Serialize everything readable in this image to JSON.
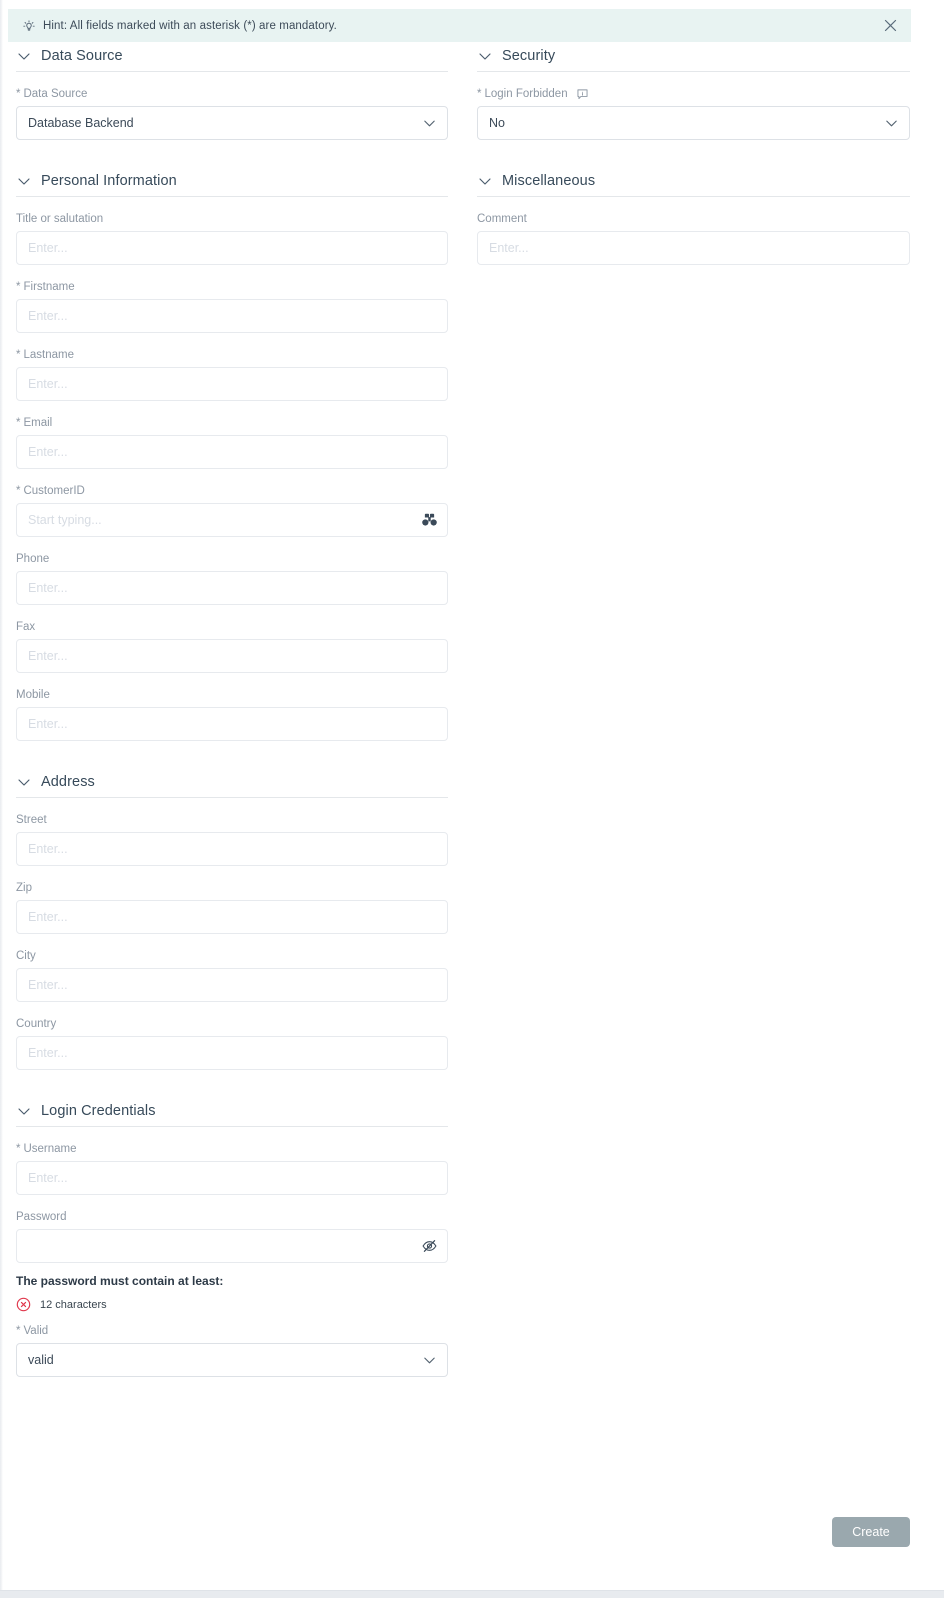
{
  "hint": {
    "icon": "lightbulb-icon",
    "text": "Hint: All fields marked with an asterisk (*) are mandatory.",
    "close_icon": "close-icon",
    "background_color": "#e8f3f2"
  },
  "placeholders": {
    "enter": "Enter...",
    "start_typing": "Start typing..."
  },
  "left_column": {
    "sections": [
      {
        "title": "Data Source",
        "chevron": "chevron-down-icon",
        "fields": [
          {
            "label": "Data Source",
            "required": true,
            "type": "select",
            "value": "Database Backend",
            "name": "data-source-select"
          }
        ]
      },
      {
        "title": "Personal Information",
        "chevron": "chevron-down-icon",
        "fields": [
          {
            "label": "Title or salutation",
            "required": false,
            "type": "text",
            "value": "",
            "placeholder": "Enter...",
            "name": "title-or-salutation-input"
          },
          {
            "label": "Firstname",
            "required": true,
            "type": "text",
            "value": "",
            "placeholder": "Enter...",
            "name": "firstname-input"
          },
          {
            "label": "Lastname",
            "required": true,
            "type": "text",
            "value": "",
            "placeholder": "Enter...",
            "name": "lastname-input"
          },
          {
            "label": "Email",
            "required": true,
            "type": "text",
            "value": "",
            "placeholder": "Enter...",
            "name": "email-input"
          },
          {
            "label": "CustomerID",
            "required": true,
            "type": "text",
            "value": "",
            "placeholder": "Start typing...",
            "icon": "binoculars-icon",
            "name": "customer-id-input"
          },
          {
            "label": "Phone",
            "required": false,
            "type": "text",
            "value": "",
            "placeholder": "Enter...",
            "name": "phone-input"
          },
          {
            "label": "Fax",
            "required": false,
            "type": "text",
            "value": "",
            "placeholder": "Enter...",
            "name": "fax-input"
          },
          {
            "label": "Mobile",
            "required": false,
            "type": "text",
            "value": "",
            "placeholder": "Enter...",
            "name": "mobile-input"
          }
        ]
      },
      {
        "title": "Address",
        "chevron": "chevron-down-icon",
        "fields": [
          {
            "label": "Street",
            "required": false,
            "type": "text",
            "value": "",
            "placeholder": "Enter...",
            "name": "street-input"
          },
          {
            "label": "Zip",
            "required": false,
            "type": "text",
            "value": "",
            "placeholder": "Enter...",
            "name": "zip-input"
          },
          {
            "label": "City",
            "required": false,
            "type": "text",
            "value": "",
            "placeholder": "Enter...",
            "name": "city-input"
          },
          {
            "label": "Country",
            "required": false,
            "type": "text",
            "value": "",
            "placeholder": "Enter...",
            "name": "country-input"
          }
        ]
      },
      {
        "title": "Login Credentials",
        "chevron": "chevron-down-icon",
        "fields": [
          {
            "label": "Username",
            "required": true,
            "type": "text",
            "value": "",
            "placeholder": "Enter...",
            "name": "username-input"
          },
          {
            "label": "Password",
            "required": false,
            "type": "password",
            "value": "",
            "placeholder": "",
            "icon": "eye-off-icon",
            "name": "password-input"
          }
        ]
      }
    ],
    "password_rules": {
      "title": "The password must contain at least:",
      "rules": [
        {
          "text": "12 characters",
          "state": "invalid",
          "icon": "x-circle-icon",
          "color": "#e0384d"
        }
      ]
    },
    "valid_field": {
      "label": "Valid",
      "required": true,
      "type": "select",
      "value": "valid",
      "name": "valid-select"
    }
  },
  "right_column": {
    "sections": [
      {
        "title": "Security",
        "chevron": "chevron-down-icon",
        "fields": [
          {
            "label": "Login Forbidden",
            "required": true,
            "type": "select",
            "value": "No",
            "info_icon": "info-bubble-icon",
            "name": "login-forbidden-select"
          }
        ]
      },
      {
        "title": "Miscellaneous",
        "chevron": "chevron-down-icon",
        "fields": [
          {
            "label": "Comment",
            "required": false,
            "type": "text",
            "value": "",
            "placeholder": "Enter...",
            "name": "comment-input"
          }
        ]
      }
    ]
  },
  "footer": {
    "create_label": "Create",
    "create_button_color": "#9aa8ae"
  }
}
